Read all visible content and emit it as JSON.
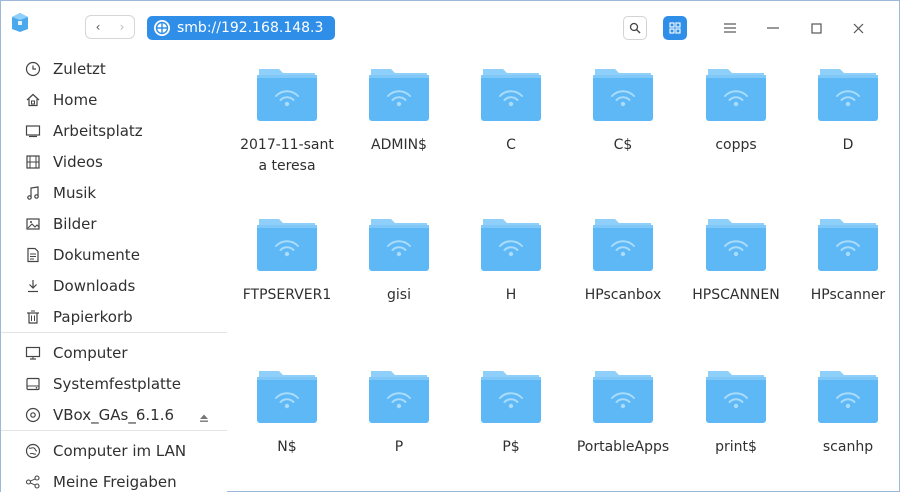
{
  "window": {
    "address": "smb://192.168.148.3"
  },
  "toolbar": {
    "back_icon": "chevron-left-icon",
    "forward_icon": "chevron-right-icon",
    "search_icon": "search-icon",
    "view_icon": "grid-view-icon",
    "menu_icon": "hamburger-menu-icon",
    "minimize_icon": "minimize-icon",
    "maximize_icon": "maximize-icon",
    "close_icon": "close-icon",
    "accent_color": "#2f8fe8"
  },
  "sidebar": {
    "groups": [
      [
        {
          "label": "Zuletzt",
          "icon": "clock-icon"
        },
        {
          "label": "Home",
          "icon": "home-icon"
        },
        {
          "label": "Arbeitsplatz",
          "icon": "desktop-icon"
        },
        {
          "label": "Videos",
          "icon": "film-icon"
        },
        {
          "label": "Musik",
          "icon": "music-icon"
        },
        {
          "label": "Bilder",
          "icon": "image-icon"
        },
        {
          "label": "Dokumente",
          "icon": "document-icon"
        },
        {
          "label": "Downloads",
          "icon": "download-icon"
        },
        {
          "label": "Papierkorb",
          "icon": "trash-icon"
        }
      ],
      [
        {
          "label": "Computer",
          "icon": "monitor-icon"
        },
        {
          "label": "Systemfestplatte",
          "icon": "harddisk-icon"
        },
        {
          "label": "VBox_GAs_6.1.6",
          "icon": "disc-icon"
        }
      ],
      [
        {
          "label": "Computer im LAN",
          "icon": "network-icon"
        },
        {
          "label": "Meine Freigaben",
          "icon": "share-icon"
        }
      ]
    ]
  },
  "content": {
    "folder_color": "#5db8f5",
    "shares": [
      "2017-11-santa teresa",
      "ADMIN$",
      "C",
      "C$",
      "copps",
      "D",
      "FTPSERVER1",
      "gisi",
      "H",
      "HPscanbox",
      "HPSCANNEN",
      "HPscanner",
      "N$",
      "P",
      "P$",
      "PortableApps",
      "print$",
      "scanhp"
    ]
  }
}
